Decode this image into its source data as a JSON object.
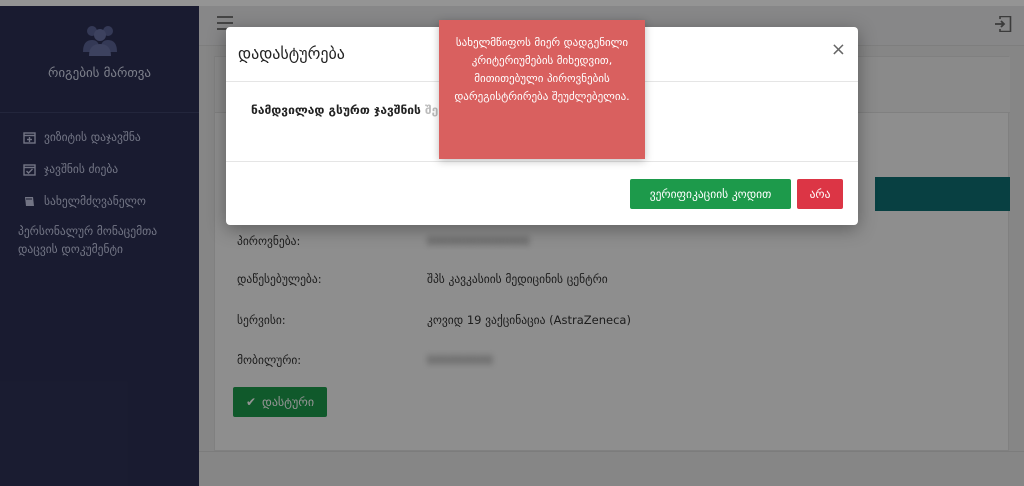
{
  "sidebar": {
    "brand_title": "რიგების მართვა",
    "items": [
      {
        "label": "ვიზიტის დაჯავშნა",
        "icon": "calendar-plus-icon"
      },
      {
        "label": "ჯავშნის ძიება",
        "icon": "calendar-check-icon"
      },
      {
        "label": "სახელმძღვანელო",
        "icon": "book-icon"
      },
      {
        "label": "პერსონალურ მონაცემთა დაცვის დოკუმენტი",
        "icon": ""
      }
    ]
  },
  "details": [
    {
      "label": "პიროვნება:",
      "value": "00000000000000",
      "blurred": true
    },
    {
      "label": "დაწესებულება:",
      "value": "შპს კავკასიის მედიცინის ცენტრი",
      "blurred": false
    },
    {
      "label": "სერვისი:",
      "value": "კოვიდ 19 ვაქცინაცია (AstraZeneca)",
      "blurred": false
    },
    {
      "label": "მობილური:",
      "value": "000000000",
      "blurred": true
    }
  ],
  "confirm_button": "დასტური",
  "modal": {
    "title": "დადასტურება",
    "close": "×",
    "question": "ნამდვილად გსურთ ჯავშნის",
    "question_faded": "შექმნა?",
    "verify_button": "ვერიფიკაციის კოდით",
    "no_button": "არა"
  },
  "toast": {
    "message": "სახელმწიფოს მიერ დადგენილი კრიტერიუმების მიხედვით, მითითებული პიროვნების დარეგისტრირება შეუძლებელია."
  },
  "colors": {
    "sidebar": "#2c3054",
    "success": "#1d9a4b",
    "danger": "#dc3545",
    "toast": "#d9605f",
    "teal": "#0f6f73"
  }
}
